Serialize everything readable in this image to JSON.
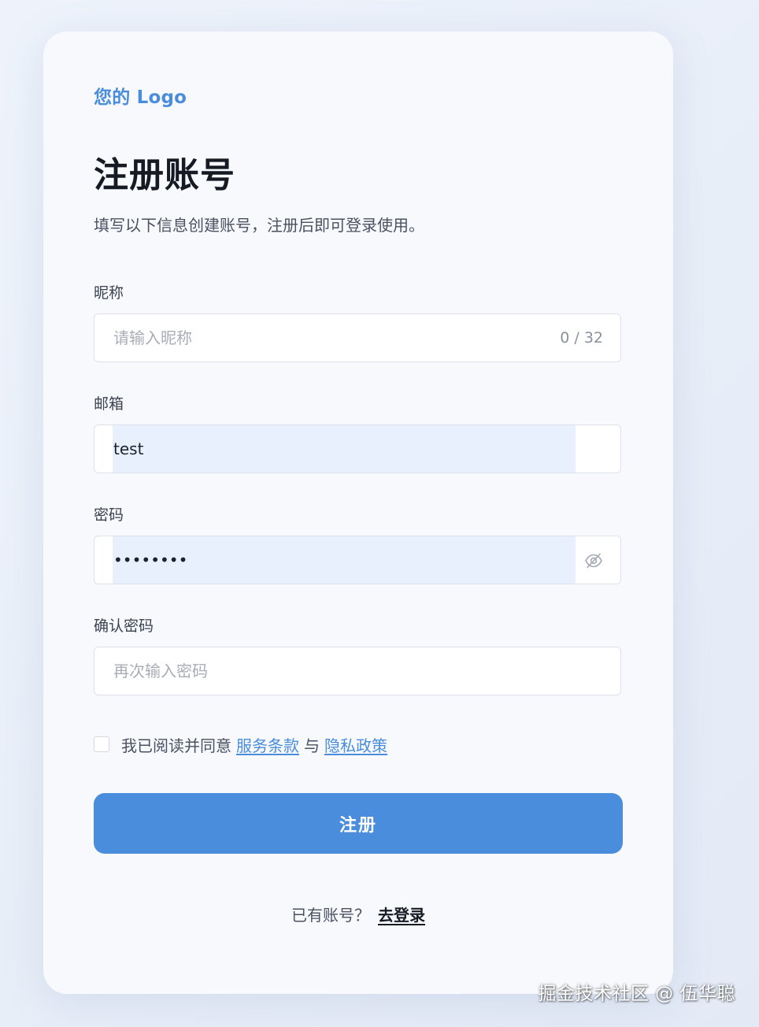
{
  "brand": {
    "logo_text": "您的 Logo",
    "accent_color": "#4a8ddc"
  },
  "page": {
    "title": "注册账号",
    "subtitle": "填写以下信息创建账号，注册后即可登录使用。"
  },
  "form": {
    "nickname": {
      "label": "昵称",
      "placeholder": "请输入昵称",
      "value": "",
      "counter": "0 / 32"
    },
    "email": {
      "label": "邮箱",
      "value": "test"
    },
    "password": {
      "label": "密码",
      "value": "12345678",
      "visibility_icon": "eye-off-icon"
    },
    "confirm_password": {
      "label": "确认密码",
      "placeholder": "再次输入密码",
      "value": ""
    },
    "agreement": {
      "checked": false,
      "prefix": "我已阅读并同意",
      "terms_link": "服务条款",
      "conjunction": "与",
      "privacy_link": "隐私政策"
    },
    "submit_label": "注册"
  },
  "footer": {
    "prompt": "已有账号？",
    "login_link": "去登录"
  },
  "watermark": "掘金技术社区 @ 伍华聪"
}
